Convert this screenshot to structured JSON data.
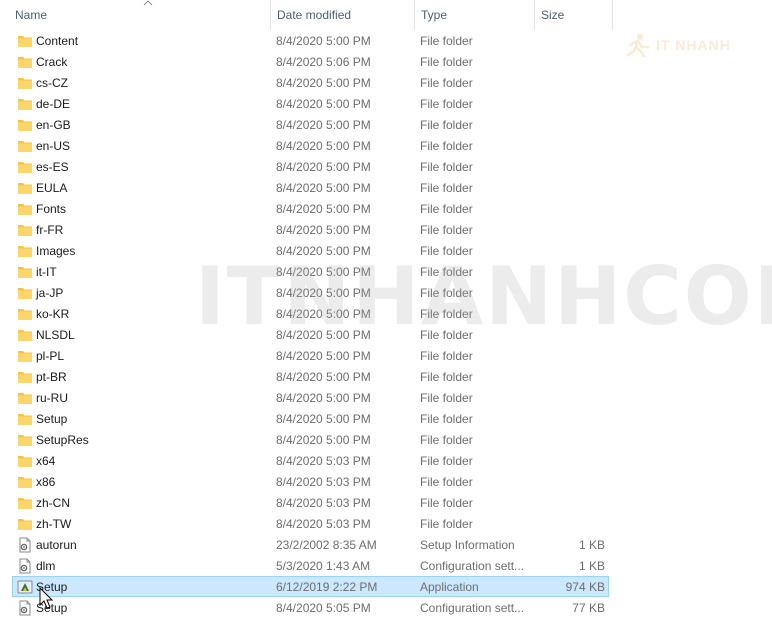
{
  "columns": {
    "name": "Name",
    "date_modified": "Date modified",
    "type": "Type",
    "size": "Size"
  },
  "watermark": "ITNHANHCOM",
  "logo": "IT NHANH",
  "accent_colors": {
    "selection_bg": "#cce8ff",
    "selection_border": "#99d1ff",
    "folder": "#f7c24a",
    "header_text": "#4c607a"
  },
  "rows": [
    {
      "name": "Content",
      "date": "8/4/2020 5:00 PM",
      "type": "File folder",
      "size": "",
      "icon": "folder-icon"
    },
    {
      "name": "Crack",
      "date": "8/4/2020 5:06 PM",
      "type": "File folder",
      "size": "",
      "icon": "folder-icon"
    },
    {
      "name": "cs-CZ",
      "date": "8/4/2020 5:00 PM",
      "type": "File folder",
      "size": "",
      "icon": "folder-icon"
    },
    {
      "name": "de-DE",
      "date": "8/4/2020 5:00 PM",
      "type": "File folder",
      "size": "",
      "icon": "folder-icon"
    },
    {
      "name": "en-GB",
      "date": "8/4/2020 5:00 PM",
      "type": "File folder",
      "size": "",
      "icon": "folder-icon"
    },
    {
      "name": "en-US",
      "date": "8/4/2020 5:00 PM",
      "type": "File folder",
      "size": "",
      "icon": "folder-icon"
    },
    {
      "name": "es-ES",
      "date": "8/4/2020 5:00 PM",
      "type": "File folder",
      "size": "",
      "icon": "folder-icon"
    },
    {
      "name": "EULA",
      "date": "8/4/2020 5:00 PM",
      "type": "File folder",
      "size": "",
      "icon": "folder-icon"
    },
    {
      "name": "Fonts",
      "date": "8/4/2020 5:00 PM",
      "type": "File folder",
      "size": "",
      "icon": "folder-icon"
    },
    {
      "name": "fr-FR",
      "date": "8/4/2020 5:00 PM",
      "type": "File folder",
      "size": "",
      "icon": "folder-icon"
    },
    {
      "name": "Images",
      "date": "8/4/2020 5:00 PM",
      "type": "File folder",
      "size": "",
      "icon": "folder-icon"
    },
    {
      "name": "it-IT",
      "date": "8/4/2020 5:00 PM",
      "type": "File folder",
      "size": "",
      "icon": "folder-icon"
    },
    {
      "name": "ja-JP",
      "date": "8/4/2020 5:00 PM",
      "type": "File folder",
      "size": "",
      "icon": "folder-icon"
    },
    {
      "name": "ko-KR",
      "date": "8/4/2020 5:00 PM",
      "type": "File folder",
      "size": "",
      "icon": "folder-icon"
    },
    {
      "name": "NLSDL",
      "date": "8/4/2020 5:00 PM",
      "type": "File folder",
      "size": "",
      "icon": "folder-icon"
    },
    {
      "name": "pl-PL",
      "date": "8/4/2020 5:00 PM",
      "type": "File folder",
      "size": "",
      "icon": "folder-icon"
    },
    {
      "name": "pt-BR",
      "date": "8/4/2020 5:00 PM",
      "type": "File folder",
      "size": "",
      "icon": "folder-icon"
    },
    {
      "name": "ru-RU",
      "date": "8/4/2020 5:00 PM",
      "type": "File folder",
      "size": "",
      "icon": "folder-icon"
    },
    {
      "name": "Setup",
      "date": "8/4/2020 5:00 PM",
      "type": "File folder",
      "size": "",
      "icon": "folder-icon"
    },
    {
      "name": "SetupRes",
      "date": "8/4/2020 5:00 PM",
      "type": "File folder",
      "size": "",
      "icon": "folder-icon"
    },
    {
      "name": "x64",
      "date": "8/4/2020 5:03 PM",
      "type": "File folder",
      "size": "",
      "icon": "folder-icon"
    },
    {
      "name": "x86",
      "date": "8/4/2020 5:03 PM",
      "type": "File folder",
      "size": "",
      "icon": "folder-icon"
    },
    {
      "name": "zh-CN",
      "date": "8/4/2020 5:03 PM",
      "type": "File folder",
      "size": "",
      "icon": "folder-icon"
    },
    {
      "name": "zh-TW",
      "date": "8/4/2020 5:03 PM",
      "type": "File folder",
      "size": "",
      "icon": "folder-icon"
    },
    {
      "name": "autorun",
      "date": "23/2/2002 8:35 AM",
      "type": "Setup Information",
      "size": "1 KB",
      "icon": "config-file-icon"
    },
    {
      "name": "dlm",
      "date": "5/3/2020 1:43 AM",
      "type": "Configuration sett...",
      "size": "1 KB",
      "icon": "config-file-icon"
    },
    {
      "name": "Setup",
      "date": "6/12/2019 2:22 PM",
      "type": "Application",
      "size": "974 KB",
      "icon": "application-icon",
      "selected": true
    },
    {
      "name": "Setup",
      "date": "8/4/2020 5:05 PM",
      "type": "Configuration sett...",
      "size": "77 KB",
      "icon": "config-file-icon"
    }
  ]
}
